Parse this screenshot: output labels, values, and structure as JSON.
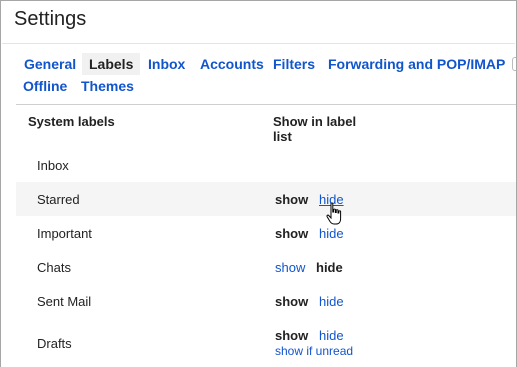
{
  "page": {
    "title": "Settings"
  },
  "tabs": [
    {
      "label": "General",
      "active": false
    },
    {
      "label": "Labels",
      "active": true
    },
    {
      "label": "Inbox",
      "active": false
    },
    {
      "label": "Accounts",
      "active": false
    },
    {
      "label": "Filters",
      "active": false
    },
    {
      "label": "Forwarding and POP/IMAP",
      "active": false
    },
    {
      "label": "Offline",
      "active": false
    },
    {
      "label": "Themes",
      "active": false
    }
  ],
  "table": {
    "col_label": "System labels",
    "col_show": "Show in label list",
    "rows": [
      {
        "label": "Inbox"
      },
      {
        "label": "Starred",
        "show": "show",
        "hide": "hide",
        "selected": "show"
      },
      {
        "label": "Important",
        "show": "show",
        "hide": "hide",
        "selected": "show"
      },
      {
        "label": "Chats",
        "show": "show",
        "hide": "hide",
        "selected": "hide"
      },
      {
        "label": "Sent Mail",
        "show": "show",
        "hide": "hide",
        "selected": "show"
      },
      {
        "label": "Drafts",
        "show": "show",
        "hide": "hide",
        "show_if_unread": "show if unread",
        "selected": "show"
      }
    ]
  },
  "colors": {
    "link": "#1155cc",
    "text": "#222222",
    "hover_row": "#f5f5f5"
  }
}
